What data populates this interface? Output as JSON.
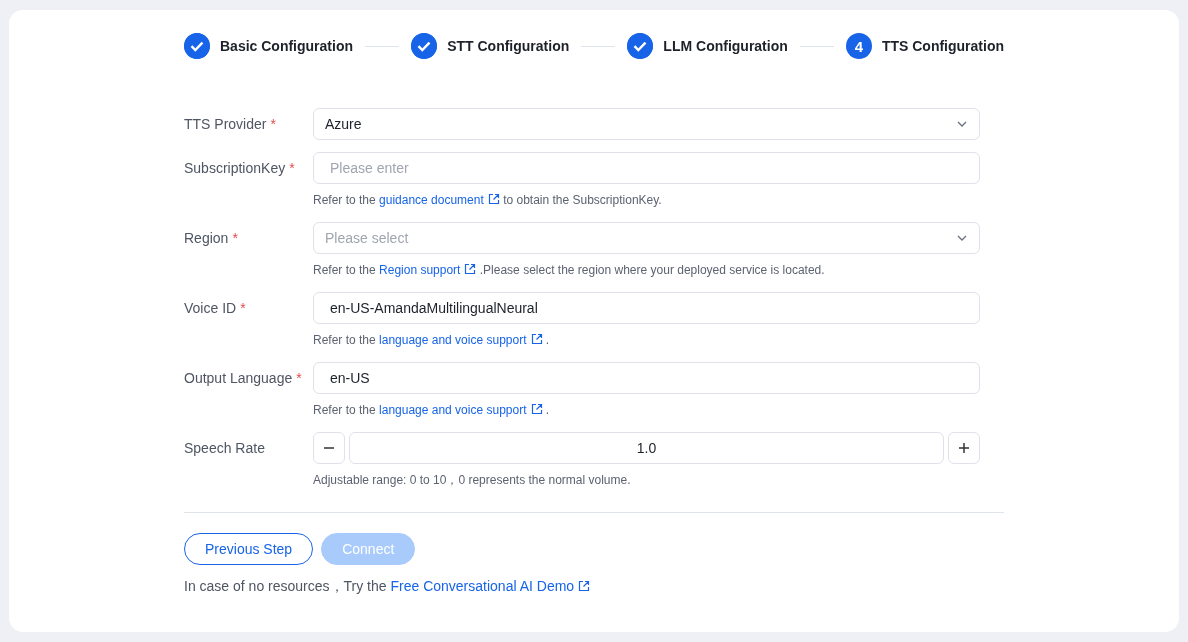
{
  "steps": [
    {
      "label": "Basic Configuration",
      "completed": true
    },
    {
      "label": "STT Configuration",
      "completed": true
    },
    {
      "label": "LLM Configuration",
      "completed": true
    },
    {
      "label": "TTS Configuration",
      "completed": false,
      "number": "4"
    }
  ],
  "fields": [
    {
      "kind": "select",
      "label": "TTS Provider",
      "required_mark": "*",
      "value": "Azure"
    },
    {
      "kind": "input",
      "label": "SubscriptionKey",
      "required_mark": "*",
      "placeholder": "Please enter",
      "hint": {
        "text_before": "Refer to the ",
        "link": "guidance document",
        "text_after": " to obtain the SubscriptionKey."
      }
    },
    {
      "kind": "select",
      "label": "Region",
      "required_mark": "*",
      "placeholder": "Please select",
      "hint": {
        "text_before": "Refer to the ",
        "link": "Region support",
        "text_after": " .Please select the region where your deployed service is located."
      }
    },
    {
      "kind": "input",
      "label": "Voice ID",
      "required_mark": "*",
      "value": "en-US-AmandaMultilingualNeural",
      "hint": {
        "text_before": "Refer to the ",
        "link": "language and voice support",
        "text_after": " ."
      }
    },
    {
      "kind": "input",
      "label": "Output Language",
      "required_mark": "*",
      "value": "en-US",
      "hint": {
        "text_before": "Refer to the ",
        "link": "language and voice support",
        "text_after": " ."
      }
    },
    {
      "kind": "stepper",
      "label": "Speech Rate",
      "value": "1.0",
      "hint": {
        "text_before": "Adjustable range: 0 to 10，0 represents the normal volume."
      }
    }
  ],
  "buttons": [
    {
      "label": "Previous Step",
      "disabled": false
    },
    {
      "label": "Connect",
      "disabled": true
    }
  ],
  "footer": {
    "text_before": "In case of no resources，Try the ",
    "link": "Free Conversational AI Demo"
  }
}
